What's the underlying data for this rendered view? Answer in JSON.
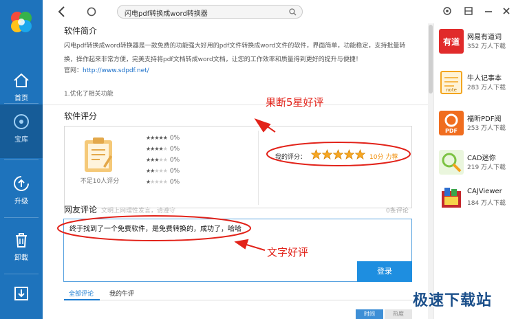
{
  "address_bar": {
    "text": "闪电pdf转换成word转换器"
  },
  "nav": {
    "items": [
      {
        "id": "home",
        "label": "首页"
      },
      {
        "id": "library",
        "label": "宝库"
      },
      {
        "id": "upgrade",
        "label": "升级"
      },
      {
        "id": "uninstall",
        "label": "卸载"
      }
    ],
    "active": "library"
  },
  "intro": {
    "title": "软件简介",
    "text": "闪电pdf转换成word转换器是一款免费的功能强大好用的pdf文件转换成word文件的软件，界面简单，功能稳定，支持批量转换，操作起来非常方便，完美支持将pdf文档转成word文档，让您的工作效率和质量得到更好的提升与便捷！",
    "homepage_label": "官网：",
    "homepage_url": "http://www.sdpdf.net/",
    "update_note": "1.优化了相关功能"
  },
  "rating": {
    "title": "软件评分",
    "insufficient": "不足10人评分",
    "distribution": [
      {
        "stars": 5,
        "pct": "0%"
      },
      {
        "stars": 4,
        "pct": "0%"
      },
      {
        "stars": 3,
        "pct": "0%"
      },
      {
        "stars": 2,
        "pct": "0%"
      },
      {
        "stars": 1,
        "pct": "0%"
      }
    ],
    "my_label": "我的评分：",
    "my_stars": 5,
    "score_text": "10分 力荐"
  },
  "comments": {
    "title": "网友评论",
    "hint": "文明上网理性发言，请遵守",
    "count": "0条评论",
    "input_value": "终于找到了一个免费软件，是免费转换的，成功了，哈哈",
    "login_label": "登录",
    "tabs": [
      "全部评论",
      "我的牛评"
    ],
    "sort": [
      "时间",
      "热度"
    ]
  },
  "apps": [
    {
      "name": "网易有道词",
      "users": "352 万人下载",
      "icon": "youdao-icon",
      "color": "#e12b2b"
    },
    {
      "name": "牛人记事本",
      "users": "283 万人下载",
      "icon": "notebook-icon",
      "color": "#f3a51f"
    },
    {
      "name": "福昕PDF阅",
      "users": "253 万人下载",
      "icon": "foxit-pdf-icon",
      "color": "#f06d1f"
    },
    {
      "name": "CAD迷你",
      "users": "219 万人下载",
      "icon": "cad-icon",
      "color": "#7cc242"
    },
    {
      "name": "CAJViewer",
      "users": "184 万人下载",
      "icon": "cajviewer-icon",
      "color": "#c4282c"
    }
  ],
  "annotations": {
    "stars_note": "果断5星好评",
    "text_note": "文字好评"
  },
  "watermark": "极速下载站"
}
